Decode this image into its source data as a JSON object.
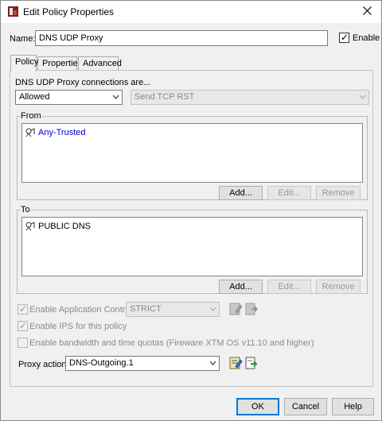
{
  "window": {
    "title": "Edit Policy Properties"
  },
  "name": {
    "label": "Name:",
    "value": "DNS UDP Proxy"
  },
  "enable": {
    "label": "Enable",
    "checked": true
  },
  "tabs": [
    {
      "label": "Policy",
      "active": true
    },
    {
      "label": "Properties",
      "active": false
    },
    {
      "label": "Advanced",
      "active": false
    }
  ],
  "policy": {
    "connections_label": "DNS UDP Proxy connections are...",
    "connections_value": "Allowed",
    "tcp_rst_value": "Send TCP RST",
    "from": {
      "legend": "From",
      "items": [
        "Any-Trusted"
      ],
      "add": "Add...",
      "edit": "Edit...",
      "remove": "Remove"
    },
    "to": {
      "legend": "To",
      "items": [
        "PUBLIC DNS"
      ],
      "add": "Add...",
      "edit": "Edit...",
      "remove": "Remove"
    },
    "app_control": {
      "label": "Enable Application Control:",
      "value": "STRICT",
      "checked": true
    },
    "ips": {
      "label": "Enable IPS for this policy",
      "checked": true
    },
    "quotas": {
      "label": "Enable bandwidth and time quotas (Fireware XTM OS v11.10 and higher)",
      "checked": false
    },
    "proxy_action": {
      "label": "Proxy action:",
      "value": "DNS-Outgoing.1"
    }
  },
  "buttons": {
    "ok": "OK",
    "cancel": "Cancel",
    "help": "Help"
  },
  "colors": {
    "link_blue": "#0000cc",
    "accent": "#0078d7"
  }
}
